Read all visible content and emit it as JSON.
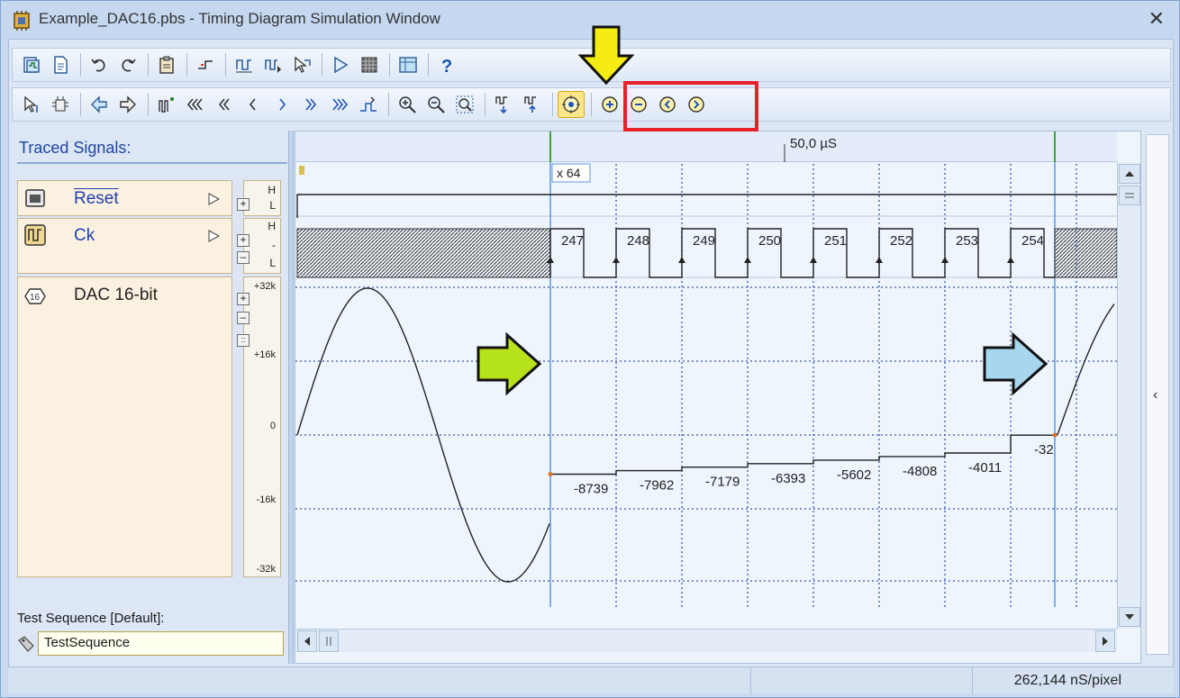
{
  "window": {
    "title": "Example_DAC16.pbs - Timing Diagram Simulation Window",
    "close_glyph": "✕"
  },
  "toolbar_top": {
    "icons": [
      "trace-signals-icon",
      "report-icon",
      "undo-icon",
      "redo-icon",
      "clipboard-icon",
      "step-icon",
      "signal-edit-icon",
      "signal-edit2-icon",
      "cursor-select-icon",
      "run-icon",
      "stop-icon",
      "grid-icon",
      "help-icon"
    ]
  },
  "toolbar_nav": {
    "icons": [
      "add-cursor-icon",
      "bug-icon",
      "arrow-left-icon",
      "arrow-right-icon",
      "scope-icon",
      "first-icon",
      "prev-fast-icon",
      "prev-icon",
      "next-icon",
      "next-fast-icon",
      "last-icon",
      "end-icon",
      "zoom-in-icon",
      "zoom-out-icon",
      "zoom-fit-icon",
      "split-icon",
      "join-icon",
      "center-icon",
      "zoom-plus-icon",
      "zoom-minus-icon",
      "pan-left-icon",
      "pan-right-icon"
    ]
  },
  "left_panel": {
    "traced_label": "Traced Signals:",
    "signals": [
      {
        "name": "Reset",
        "levels": [
          "H",
          "L"
        ]
      },
      {
        "name": "Ck",
        "levels": [
          "H",
          "-",
          "L"
        ]
      },
      {
        "name": "DAC 16-bit",
        "levels": []
      }
    ],
    "test_sequence_label": "Test Sequence [Default]:",
    "test_sequence_value": "TestSequence"
  },
  "ruler": {
    "time_label": "50,0 µS"
  },
  "cursor_label": "x 64",
  "clock_counts": [
    "247",
    "248",
    "249",
    "250",
    "251",
    "252",
    "253",
    "254"
  ],
  "dac_axis": [
    "+32k",
    "+16k",
    "0",
    "-16k",
    "-32k"
  ],
  "dac_values": [
    "-8739",
    "-7962",
    "-7179",
    "-6393",
    "-5602",
    "-4808",
    "-4011",
    "-32"
  ],
  "statusbar": {
    "scale": "262,144 nS/pixel"
  },
  "colors": {
    "accent": "#2146a2",
    "red_box": "#e8202a",
    "yellow_arrow": "#f5ec13",
    "green_arrow": "#b6e21c",
    "blue_arrow": "#a8d6ee",
    "cursor_line": "#5b9ae0"
  }
}
